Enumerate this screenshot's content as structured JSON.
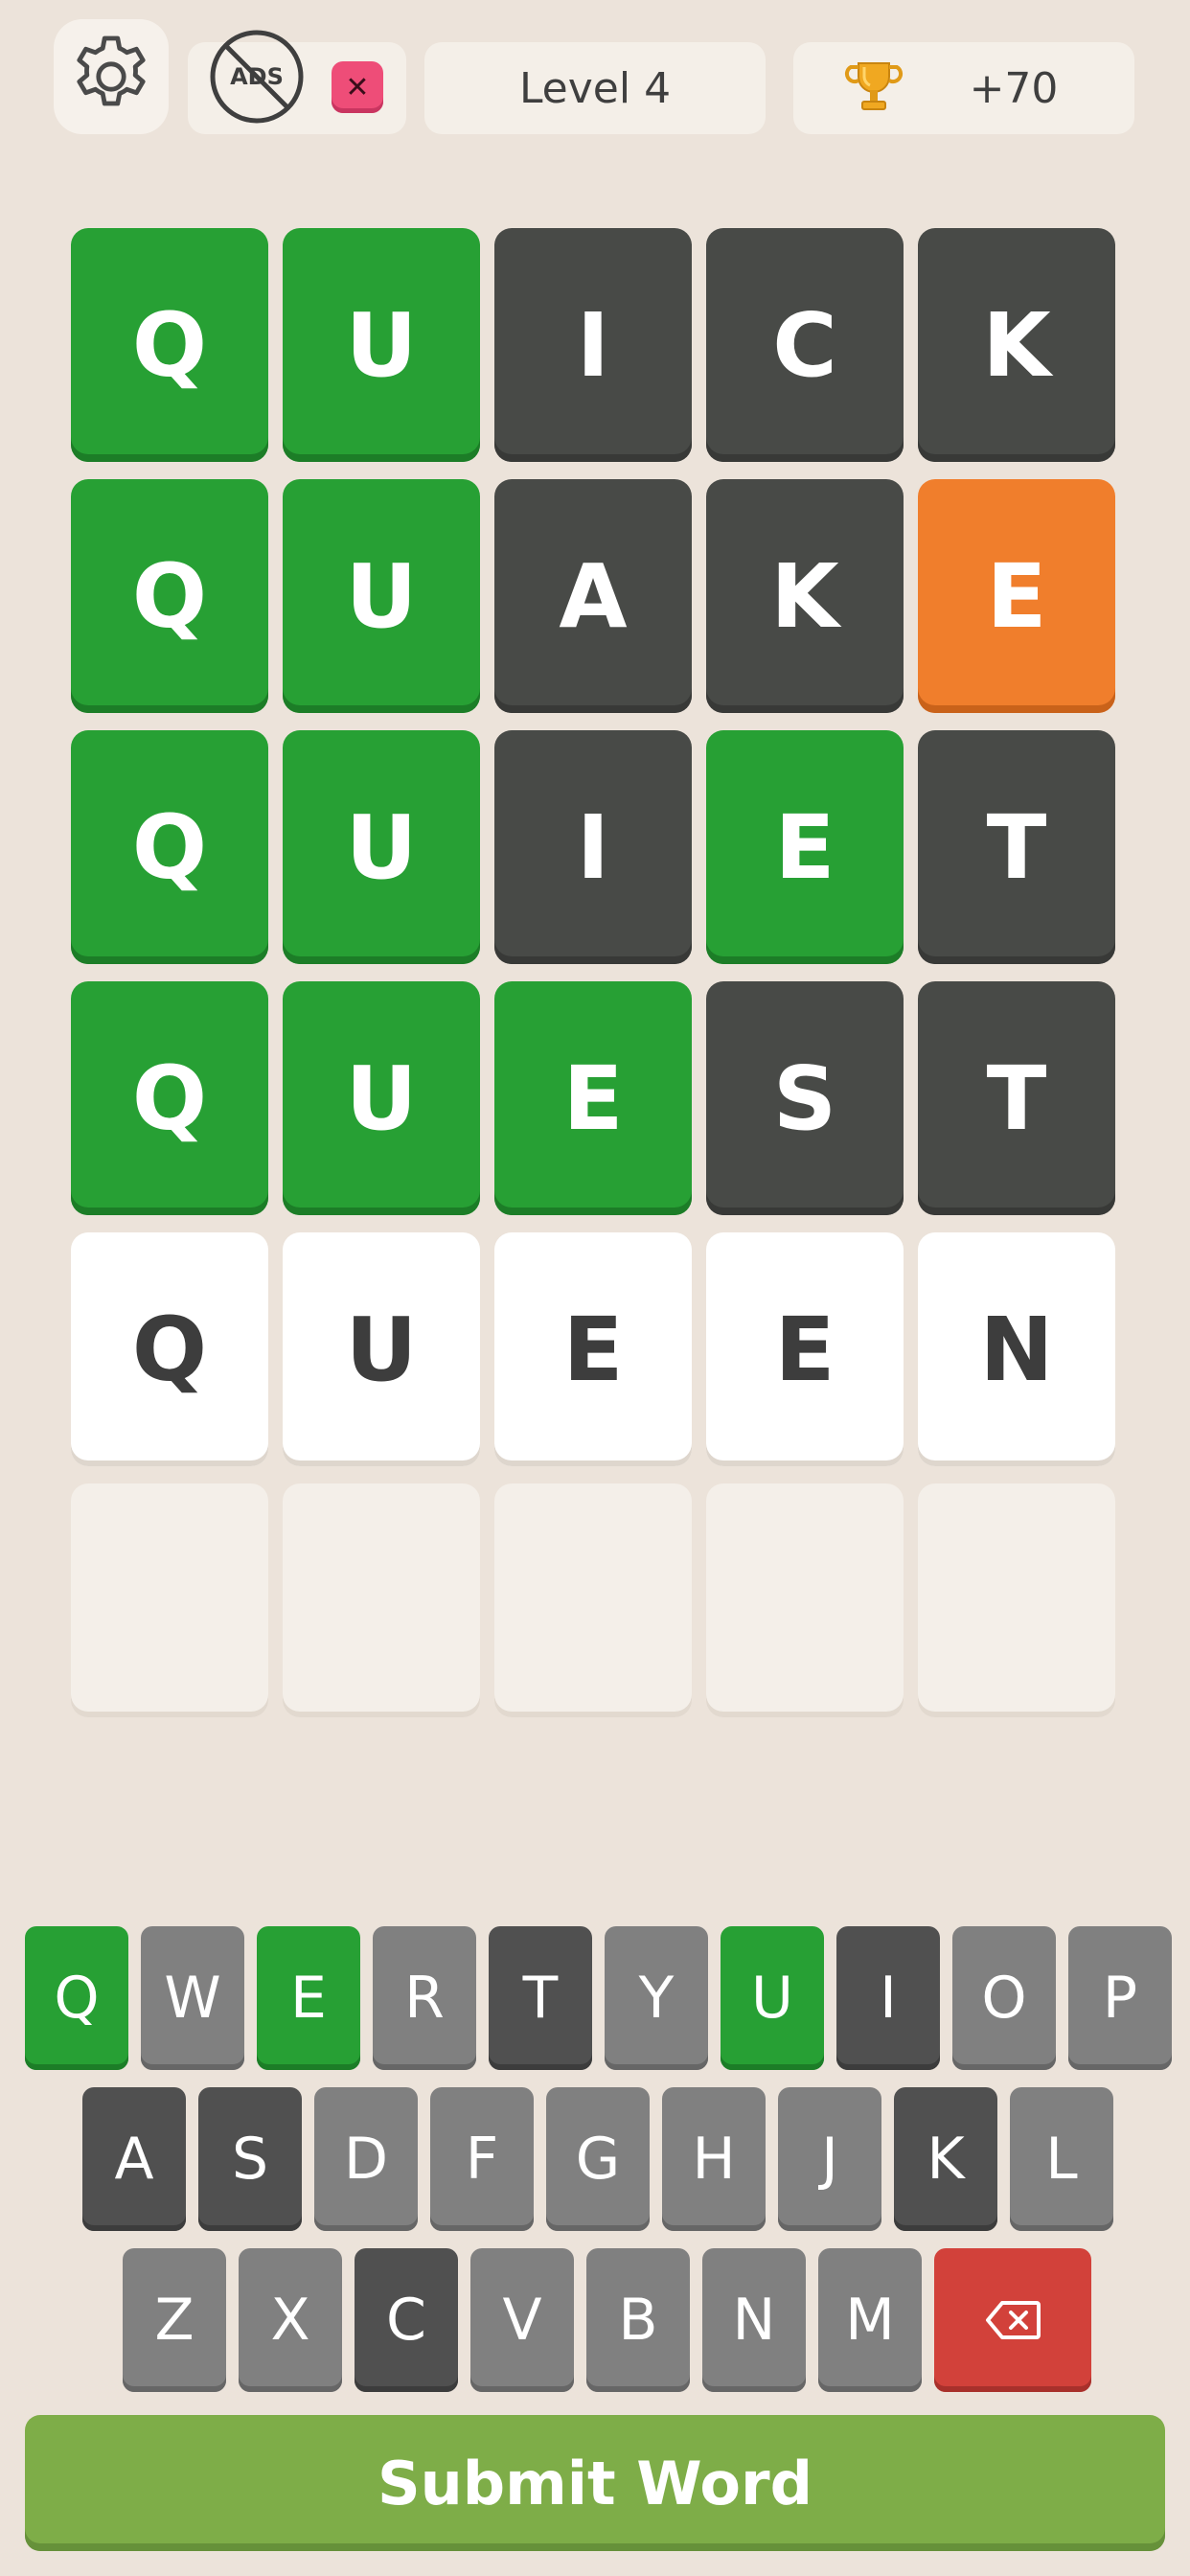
{
  "header": {
    "level_label": "Level 4",
    "score_label": "+70",
    "ads_label": "ADS",
    "close_glyph": "✕"
  },
  "board": {
    "rows": [
      [
        {
          "letter": "Q",
          "state": "correct"
        },
        {
          "letter": "U",
          "state": "correct"
        },
        {
          "letter": "I",
          "state": "absent"
        },
        {
          "letter": "C",
          "state": "absent"
        },
        {
          "letter": "K",
          "state": "absent"
        }
      ],
      [
        {
          "letter": "Q",
          "state": "correct"
        },
        {
          "letter": "U",
          "state": "correct"
        },
        {
          "letter": "A",
          "state": "absent"
        },
        {
          "letter": "K",
          "state": "absent"
        },
        {
          "letter": "E",
          "state": "present"
        }
      ],
      [
        {
          "letter": "Q",
          "state": "correct"
        },
        {
          "letter": "U",
          "state": "correct"
        },
        {
          "letter": "I",
          "state": "absent"
        },
        {
          "letter": "E",
          "state": "correct"
        },
        {
          "letter": "T",
          "state": "absent"
        }
      ],
      [
        {
          "letter": "Q",
          "state": "correct"
        },
        {
          "letter": "U",
          "state": "correct"
        },
        {
          "letter": "E",
          "state": "correct"
        },
        {
          "letter": "S",
          "state": "absent"
        },
        {
          "letter": "T",
          "state": "absent"
        }
      ],
      [
        {
          "letter": "Q",
          "state": "typed"
        },
        {
          "letter": "U",
          "state": "typed"
        },
        {
          "letter": "E",
          "state": "typed"
        },
        {
          "letter": "E",
          "state": "typed"
        },
        {
          "letter": "N",
          "state": "typed"
        }
      ],
      [
        {
          "letter": "",
          "state": "empty"
        },
        {
          "letter": "",
          "state": "empty"
        },
        {
          "letter": "",
          "state": "empty"
        },
        {
          "letter": "",
          "state": "empty"
        },
        {
          "letter": "",
          "state": "empty"
        }
      ]
    ]
  },
  "keyboard": {
    "rows": [
      [
        {
          "key": "Q",
          "state": "correct"
        },
        {
          "key": "W",
          "state": "unused"
        },
        {
          "key": "E",
          "state": "correct"
        },
        {
          "key": "R",
          "state": "unused"
        },
        {
          "key": "T",
          "state": "absent"
        },
        {
          "key": "Y",
          "state": "unused"
        },
        {
          "key": "U",
          "state": "correct"
        },
        {
          "key": "I",
          "state": "absent"
        },
        {
          "key": "O",
          "state": "unused"
        },
        {
          "key": "P",
          "state": "unused"
        }
      ],
      [
        {
          "key": "A",
          "state": "absent"
        },
        {
          "key": "S",
          "state": "absent"
        },
        {
          "key": "D",
          "state": "unused"
        },
        {
          "key": "F",
          "state": "unused"
        },
        {
          "key": "G",
          "state": "unused"
        },
        {
          "key": "H",
          "state": "unused"
        },
        {
          "key": "J",
          "state": "unused"
        },
        {
          "key": "K",
          "state": "absent"
        },
        {
          "key": "L",
          "state": "unused"
        }
      ],
      [
        {
          "key": "Z",
          "state": "unused"
        },
        {
          "key": "X",
          "state": "unused"
        },
        {
          "key": "C",
          "state": "absent"
        },
        {
          "key": "V",
          "state": "unused"
        },
        {
          "key": "B",
          "state": "unused"
        },
        {
          "key": "N",
          "state": "unused"
        },
        {
          "key": "M",
          "state": "unused"
        }
      ]
    ]
  },
  "submit_label": "Submit Word",
  "colors": {
    "correct": "#27a034",
    "absent": "#484a47",
    "present": "#f07e2c",
    "key_unused": "#808080",
    "delete": "#d2413a",
    "submit": "#7ead48",
    "background": "#ece3da"
  }
}
